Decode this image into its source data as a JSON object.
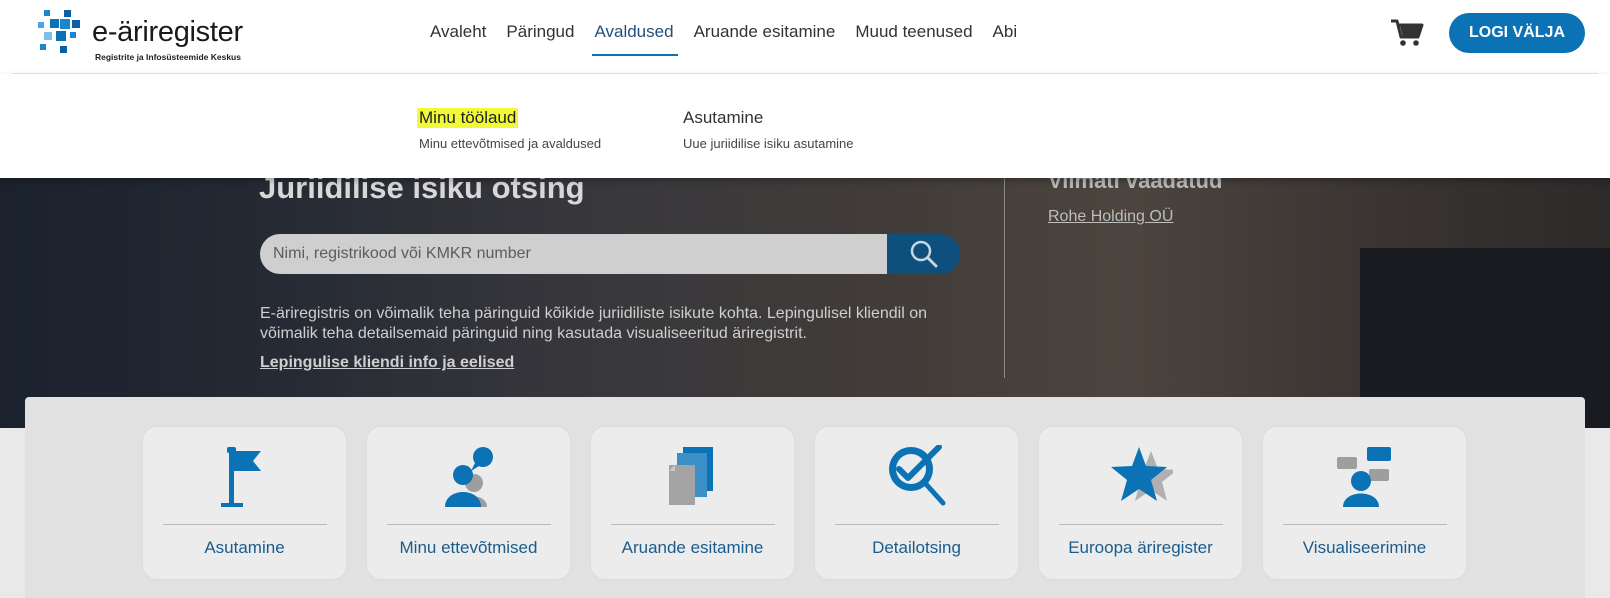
{
  "header": {
    "logo_title": "e-äriregister",
    "logo_subtitle": "Registrite ja Infosüsteemide Keskus",
    "nav": [
      "Avaleht",
      "Päringud",
      "Avaldused",
      "Aruande esitamine",
      "Muud teenused",
      "Abi"
    ],
    "active_nav": "Avaldused",
    "cart_icon": "shopping-cart-icon",
    "logout_label": "LOGI VÄLJA"
  },
  "dropdown": {
    "items": [
      {
        "title": "Minu töölaud",
        "desc": "Minu ettevõtmised ja avaldused",
        "highlighted": true
      },
      {
        "title": "Asutamine",
        "desc": "Uue juriidilise isiku asutamine",
        "highlighted": false
      }
    ]
  },
  "hero": {
    "title": "Juriidilise isiku otsing",
    "search_placeholder": "Nimi, registrikood või KMKR number",
    "description": "E-äriregistris on võimalik teha päringuid kõikide juriidiliste isikute kohta. Lepingulisel kliendil on võimalik teha detailsemaid päringuid ning kasutada visualiseeritud äriregistrit.",
    "link": "Lepingulise kliendi info ja eelised",
    "recent_title": "Viimati vaadatud",
    "recent_link": "Rohe Holding OÜ"
  },
  "services": {
    "tiles": [
      {
        "label": "Asutamine",
        "icon": "flag-icon"
      },
      {
        "label": "Minu ettevõtmised",
        "icon": "person-chat-icon"
      },
      {
        "label": "Aruande esitamine",
        "icon": "documents-icon"
      },
      {
        "label": "Detailotsing",
        "icon": "search-check-icon"
      },
      {
        "label": "Euroopa äriregister",
        "icon": "star-icon"
      },
      {
        "label": "Visualiseerimine",
        "icon": "visualization-icon"
      }
    ]
  },
  "colors": {
    "brand_blue": "#0b72b5",
    "highlight_yellow": "#f0fa36",
    "tile_label": "#1a5c8c"
  }
}
